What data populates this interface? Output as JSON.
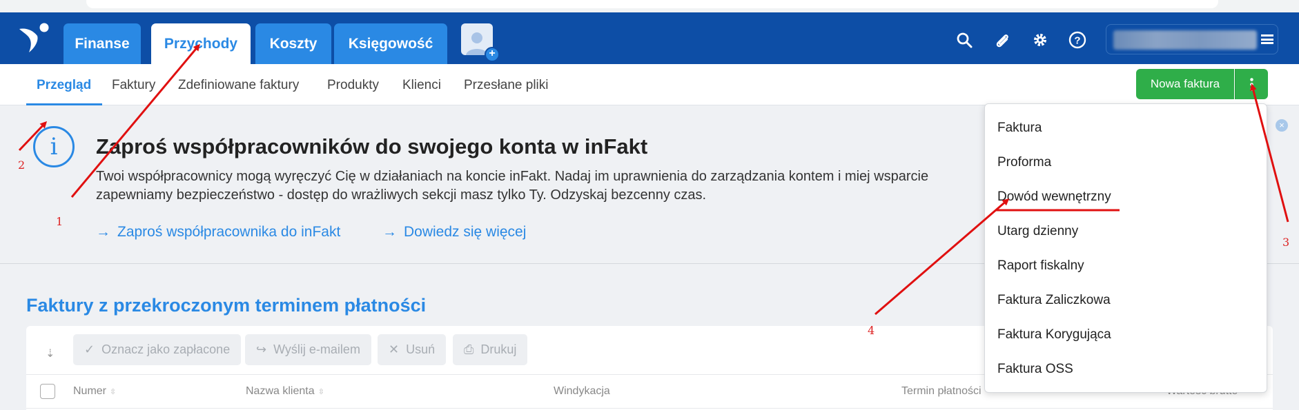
{
  "topbar": {
    "tabs": [
      {
        "label": "Finanse",
        "active": false
      },
      {
        "label": "Przychody",
        "active": true
      },
      {
        "label": "Koszty",
        "active": false
      },
      {
        "label": "Księgowość",
        "active": false
      }
    ],
    "icons": [
      "search-icon",
      "paperclip-icon",
      "gear-icon",
      "help-icon",
      "hamburger-icon"
    ]
  },
  "subnav": {
    "items": [
      "Przegląd",
      "Faktury",
      "Zdefiniowane faktury",
      "Produkty",
      "Klienci",
      "Przesłane pliki"
    ],
    "active": "Przegląd",
    "new_invoice_label": "Nowa faktura"
  },
  "banner": {
    "title": "Zaproś współpracowników do swojego konta w inFakt",
    "text": "Twoi współpracownicy mogą wyręczyć Cię w działaniach na koncie inFakt. Nadaj im uprawnienia do zarządzania kontem i miej wsparcie zapewniamy bezpieczeństwo - dostęp do wrażliwych sekcji masz tylko Ty. Odzyskaj bezcenny czas.",
    "link_invite": "Zaproś współpracownika do inFakt",
    "link_more": "Dowiedz się więcej"
  },
  "overdue": {
    "title": "Faktury z przekroczonym terminem płatności",
    "actions": [
      "Oznacz jako zapłacone",
      "Wyślij e-mailem",
      "Usuń",
      "Drukuj"
    ],
    "columns": [
      "Numer",
      "Nazwa klienta",
      "Windykacja",
      "Termin płatności",
      "Wartość brutto"
    ]
  },
  "dropdown": {
    "items": [
      "Faktura",
      "Proforma",
      "Dowód wewnętrzny",
      "Utarg dzienny",
      "Raport fiskalny",
      "Faktura Zaliczkowa",
      "Faktura Korygująca",
      "Faktura OSS"
    ]
  },
  "annotations": {
    "labels": [
      "1",
      "2",
      "3",
      "4"
    ],
    "color": "#e01010"
  },
  "colors": {
    "brand_dark": "#0d4ea6",
    "accent": "#2a89e4",
    "success": "#2fae49"
  }
}
